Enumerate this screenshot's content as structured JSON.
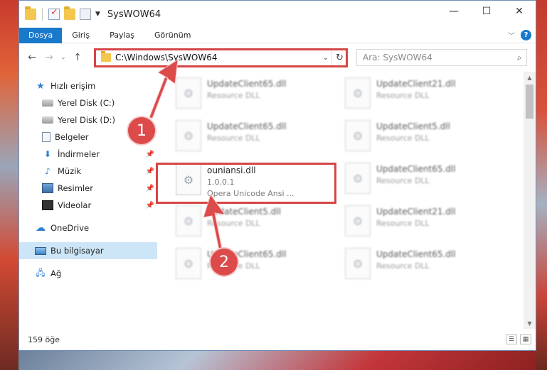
{
  "window": {
    "title": "SysWOW64",
    "controls": {
      "minimize": "—",
      "maximize": "☐",
      "close": "✕"
    }
  },
  "ribbon": {
    "tabs": [
      "Dosya",
      "Giriş",
      "Paylaş",
      "Görünüm"
    ],
    "help": "?"
  },
  "address_bar": {
    "path": "C:\\Windows\\SysWOW64",
    "refresh_icon": "refresh-icon"
  },
  "search": {
    "placeholder": "Ara: SysWOW64"
  },
  "sidebar": {
    "items": [
      {
        "label": "Hızlı erişim",
        "icon": "star-icon",
        "pinned": false
      },
      {
        "label": "Yerel Disk (C:)",
        "icon": "drive-icon",
        "pinned": false
      },
      {
        "label": "Yerel Disk (D:)",
        "icon": "drive-icon",
        "pinned": false
      },
      {
        "label": "Belgeler",
        "icon": "document-icon",
        "pinned": false
      },
      {
        "label": "İndirmeler",
        "icon": "download-icon",
        "pinned": true
      },
      {
        "label": "Müzik",
        "icon": "music-icon",
        "pinned": true
      },
      {
        "label": "Resimler",
        "icon": "pictures-icon",
        "pinned": true
      },
      {
        "label": "Videolar",
        "icon": "video-icon",
        "pinned": true
      },
      {
        "label": "OneDrive",
        "icon": "cloud-icon",
        "pinned": false
      },
      {
        "label": "Bu bilgisayar",
        "icon": "computer-icon",
        "pinned": false,
        "selected": true
      },
      {
        "label": "Ağ",
        "icon": "network-icon",
        "pinned": false
      }
    ]
  },
  "files": [
    {
      "name": "UpdateClient65.dll",
      "sub": "Resource DLL",
      "blurred": true
    },
    {
      "name": "UpdateClient21.dll",
      "sub": "Resource DLL",
      "blurred": true
    },
    {
      "name": "UpdateClient65.dll",
      "sub": "Resource DLL",
      "blurred": true
    },
    {
      "name": "UpdateClient5.dll",
      "sub": "Resource DLL",
      "blurred": true
    },
    {
      "name": "ouniansi.dll",
      "version": "1.0.0.1",
      "sub": "Opera Unicode Ansi ...",
      "blurred": false
    },
    {
      "name": "UpdateClient65.dll",
      "sub": "Resource DLL",
      "blurred": true
    },
    {
      "name": "UpdateClient5.dll",
      "sub": "Resource DLL",
      "blurred": true
    },
    {
      "name": "UpdateClient21.dll",
      "sub": "Resource DLL",
      "blurred": true
    },
    {
      "name": "UpdateClient65.dll",
      "sub": "Resource DLL",
      "blurred": true
    },
    {
      "name": "UpdateClient65.dll",
      "sub": "Resource DLL",
      "blurred": true
    }
  ],
  "status": {
    "item_count": "159 öğe"
  },
  "callouts": {
    "one": "1",
    "two": "2"
  },
  "colors": {
    "accent": "#1979ca",
    "highlight": "#d64545",
    "selected": "#cde6f7"
  }
}
